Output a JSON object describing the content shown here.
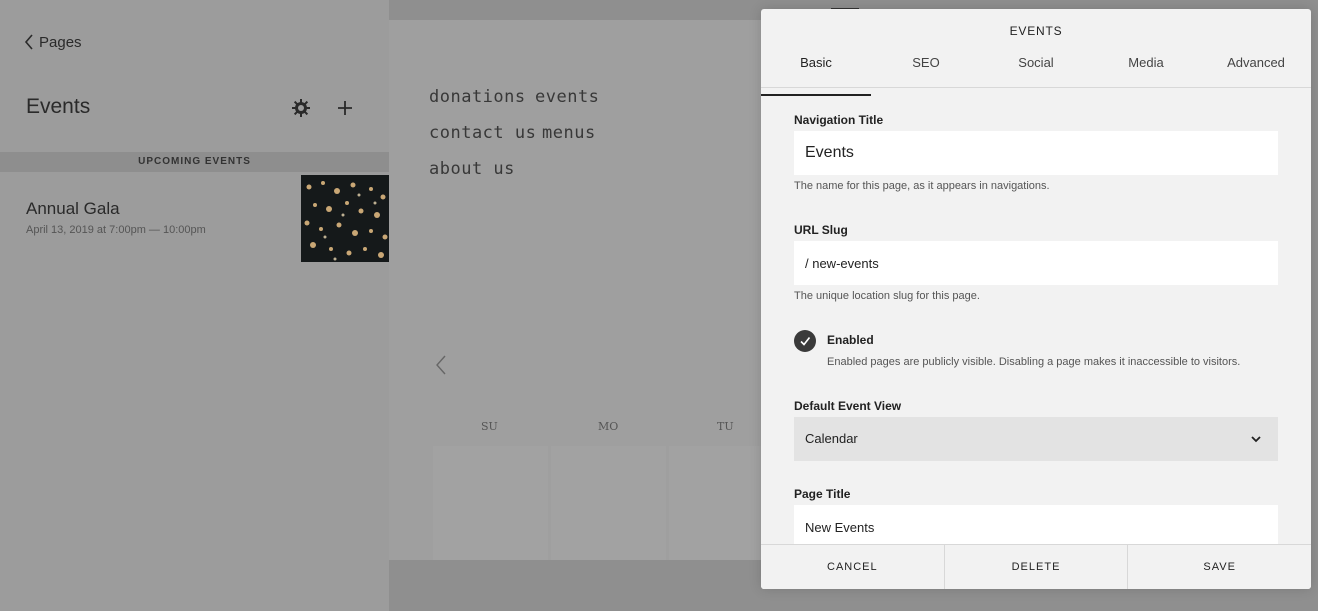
{
  "sidebar": {
    "back_label": "Pages",
    "title": "Events",
    "section_label": "UPCOMING EVENTS",
    "events": [
      {
        "name": "Annual Gala",
        "date": "April 13, 2019 at 7:00pm — 10:00pm"
      }
    ]
  },
  "preview": {
    "nav_links": [
      "donations",
      "events",
      "contact us",
      "menus",
      "about us"
    ],
    "calendar_days": [
      "SU",
      "MO",
      "TU"
    ]
  },
  "dialog": {
    "title": "EVENTS",
    "tabs": [
      "Basic",
      "SEO",
      "Social",
      "Media",
      "Advanced"
    ],
    "active_tab": "Basic",
    "navigation_title": {
      "label": "Navigation Title",
      "value": "Events",
      "help": "The name for this page, as it appears in navigations."
    },
    "url_slug": {
      "label": "URL Slug",
      "value": "/ new-events",
      "help": "The unique location slug for this page."
    },
    "enabled": {
      "label": "Enabled",
      "checked": true,
      "help": "Enabled pages are publicly visible. Disabling a page makes it inaccessible to visitors."
    },
    "default_event_view": {
      "label": "Default Event View",
      "value": "Calendar"
    },
    "page_title": {
      "label": "Page Title",
      "value": "New Events"
    },
    "buttons": {
      "cancel": "CANCEL",
      "delete": "DELETE",
      "save": "SAVE"
    }
  },
  "colors": {
    "overlay": "#8f8f8f",
    "dialog_bg": "#f2f2f2",
    "check": "#3a3a3a"
  }
}
